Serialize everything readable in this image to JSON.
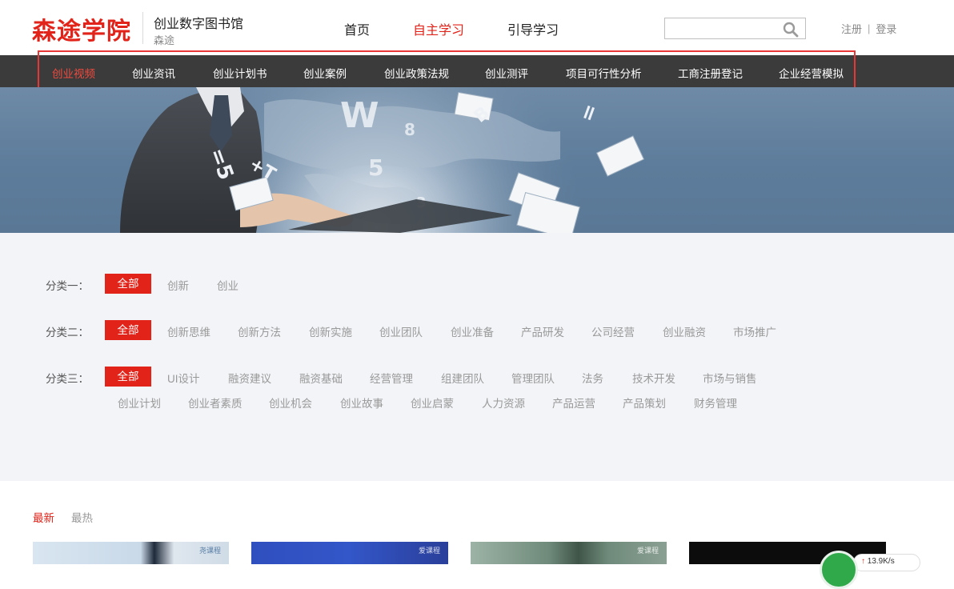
{
  "brand": {
    "logo_text": "森途学院",
    "library_title": "创业数字图书馆",
    "library_subtitle": "森途",
    "accent_color": "#e2231a"
  },
  "top_nav": {
    "items": [
      {
        "label": "首页",
        "active": false
      },
      {
        "label": "自主学习",
        "active": true
      },
      {
        "label": "引导学习",
        "active": false
      }
    ]
  },
  "search": {
    "placeholder": "",
    "icon": "search-icon"
  },
  "auth": {
    "register": "注册",
    "separator": "|",
    "login": "登录"
  },
  "category_bar": {
    "items": [
      {
        "label": "创业视频",
        "active": true
      },
      {
        "label": "创业资讯",
        "active": false
      },
      {
        "label": "创业计划书",
        "active": false
      },
      {
        "label": "创业案例",
        "active": false
      },
      {
        "label": "创业政策法规",
        "active": false
      },
      {
        "label": "创业测评",
        "active": false
      },
      {
        "label": "项目可行性分析",
        "active": false
      },
      {
        "label": "工商注册登记",
        "active": false
      },
      {
        "label": "企业经营模拟",
        "active": false
      }
    ]
  },
  "filters": {
    "row1": {
      "label": "分类一：",
      "tags": [
        "全部",
        "创新",
        "创业"
      ]
    },
    "row2": {
      "label": "分类二：",
      "tags": [
        "全部",
        "创新思维",
        "创新方法",
        "创新实施",
        "创业团队",
        "创业准备",
        "产品研发",
        "公司经营",
        "创业融资",
        "市场推广"
      ]
    },
    "row3": {
      "label": "分类三：",
      "tags": [
        "全部",
        "UI设计",
        "融资建议",
        "融资基础",
        "经营管理",
        "组建团队",
        "管理团队",
        "法务",
        "技术开发",
        "市场与销售",
        "创业计划",
        "创业者素质",
        "创业机会",
        "创业故事",
        "创业启蒙",
        "人力资源",
        "产品运营",
        "产品策划",
        "财务管理"
      ]
    }
  },
  "sort": {
    "newest": "最新",
    "hottest": "最热"
  },
  "cards": {
    "watermarks": [
      "尧课程",
      "爱课程",
      "爱课程",
      ""
    ]
  },
  "speed_widget": {
    "arrow": "↑",
    "value": "13.9K/s"
  }
}
